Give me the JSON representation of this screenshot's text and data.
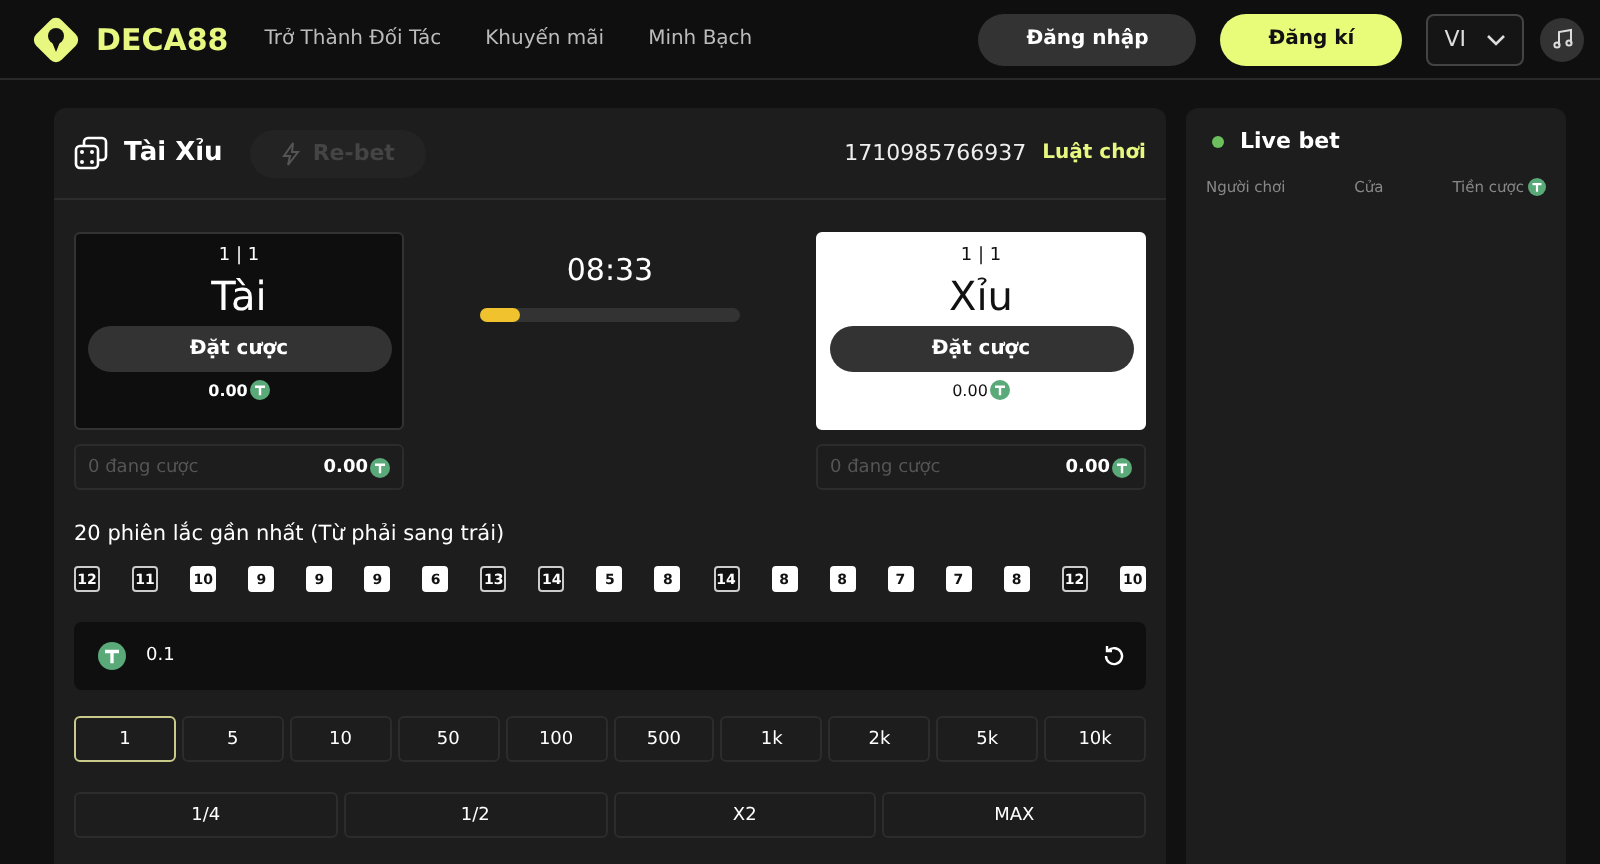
{
  "header": {
    "logo": "DECA88",
    "nav": [
      "Trở Thành Đối Tác",
      "Khuyến mãi",
      "Minh Bạch"
    ],
    "login": "Đăng nhập",
    "register": "Đăng kí",
    "language": "VI"
  },
  "game": {
    "title": "Tài Xỉu",
    "rebet": "Re-bet",
    "rebet_disabled": true,
    "round_id": "1710985766937",
    "rules": "Luật chơi",
    "sides": [
      {
        "ratio": "1 | 1",
        "name": "Tài",
        "button": "Đặt cược",
        "amount": "0.00",
        "selected": false,
        "count": "0 đang cược",
        "total": "0.00"
      },
      {
        "ratio": "1 | 1",
        "name": "Xỉu",
        "button": "Đặt cược",
        "amount": "0.00",
        "selected": true,
        "count": "0 đang cược",
        "total": "0.00"
      }
    ],
    "timer": "08:33",
    "level": 0.15,
    "history_title": "20 phiên lắc gần nhất (Từ phải sang trái)",
    "history": [
      {
        "value": "12",
        "kind": "tai"
      },
      {
        "value": "11",
        "kind": "tai"
      },
      {
        "value": "10",
        "kind": "xiu"
      },
      {
        "value": "9",
        "kind": "xiu"
      },
      {
        "value": "9",
        "kind": "xiu"
      },
      {
        "value": "9",
        "kind": "xiu"
      },
      {
        "value": "6",
        "kind": "xiu"
      },
      {
        "value": "13",
        "kind": "tai"
      },
      {
        "value": "14",
        "kind": "tai"
      },
      {
        "value": "5",
        "kind": "xiu"
      },
      {
        "value": "8",
        "kind": "xiu"
      },
      {
        "value": "14",
        "kind": "tai"
      },
      {
        "value": "8",
        "kind": "xiu"
      },
      {
        "value": "8",
        "kind": "xiu"
      },
      {
        "value": "7",
        "kind": "xiu"
      },
      {
        "value": "7",
        "kind": "xiu"
      },
      {
        "value": "8",
        "kind": "xiu"
      },
      {
        "value": "12",
        "kind": "tai"
      },
      {
        "value": "10",
        "kind": "xiu"
      }
    ],
    "amount": "0.1",
    "chips": [
      {
        "label": "1",
        "selected": true
      },
      {
        "label": "5",
        "selected": false
      },
      {
        "label": "10",
        "selected": false
      },
      {
        "label": "50",
        "selected": false
      },
      {
        "label": "100",
        "selected": false
      },
      {
        "label": "500",
        "selected": false
      },
      {
        "label": "1k",
        "selected": false
      },
      {
        "label": "2k",
        "selected": false
      },
      {
        "label": "5k",
        "selected": false
      },
      {
        "label": "10k",
        "selected": false
      }
    ],
    "multipliers": [
      "1/4",
      "1/2",
      "X2",
      "MAX"
    ]
  },
  "live_bet": {
    "title": "Live bet",
    "columns": [
      "Người chơi",
      "Cửa",
      "Tiền cược"
    ]
  }
}
